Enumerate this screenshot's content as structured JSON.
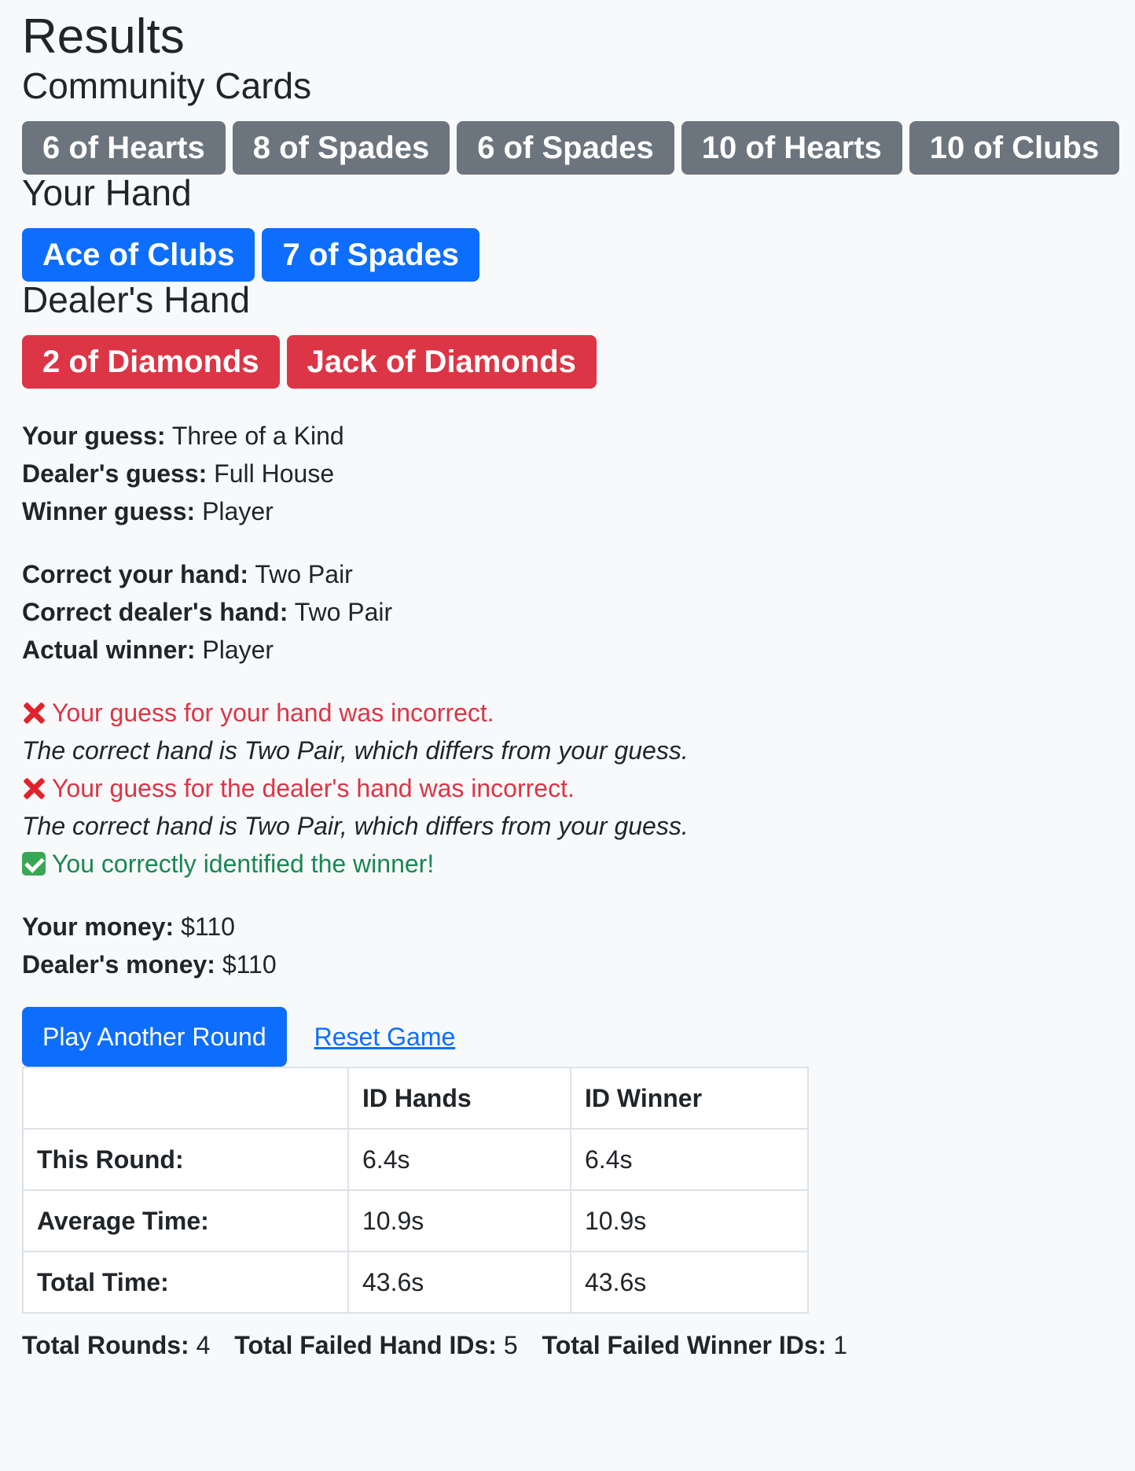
{
  "title": "Results",
  "community": {
    "heading": "Community Cards",
    "cards": [
      "6 of Hearts",
      "8 of Spades",
      "6 of Spades",
      "10 of Hearts",
      "10 of Clubs"
    ]
  },
  "your_hand": {
    "heading": "Your Hand",
    "cards": [
      "Ace of Clubs",
      "7 of Spades"
    ]
  },
  "dealer_hand": {
    "heading": "Dealer's Hand",
    "cards": [
      "2 of Diamonds",
      "Jack of Diamonds"
    ]
  },
  "guesses": {
    "your_label": "Your guess:",
    "your_value": "Three of a Kind",
    "dealer_label": "Dealer's guess:",
    "dealer_value": "Full House",
    "winner_label": "Winner guess:",
    "winner_value": "Player"
  },
  "correct": {
    "your_label": "Correct your hand:",
    "your_value": "Two Pair",
    "dealer_label": "Correct dealer's hand:",
    "dealer_value": "Two Pair",
    "winner_label": "Actual winner:",
    "winner_value": "Player"
  },
  "feedback": {
    "your_result": "Your guess for your hand was incorrect.",
    "your_explanation": "The correct hand is Two Pair, which differs from your guess.",
    "dealer_result": "Your guess for the dealer's hand was incorrect.",
    "dealer_explanation": "The correct hand is Two Pair, which differs from your guess.",
    "winner_result": "You correctly identified the winner!",
    "icons": {
      "incorrect": "cross-mark-icon",
      "correct": "check-mark-icon"
    },
    "colors": {
      "incorrect": "#dc3545",
      "correct": "#198754"
    }
  },
  "money": {
    "your_label": "Your money:",
    "your_value": "$110",
    "dealer_label": "Dealer's money:",
    "dealer_value": "$110"
  },
  "actions": {
    "play_again": "Play Another Round",
    "reset": "Reset Game"
  },
  "stats_table": {
    "headers": [
      "",
      "ID Hands",
      "ID Winner"
    ],
    "rows": [
      {
        "label": "This Round:",
        "hands": "6.4s",
        "winner": "6.4s"
      },
      {
        "label": "Average Time:",
        "hands": "10.9s",
        "winner": "10.9s"
      },
      {
        "label": "Total Time:",
        "hands": "43.6s",
        "winner": "43.6s"
      }
    ]
  },
  "totals": {
    "rounds_label": "Total Rounds:",
    "rounds_value": "4",
    "failed_hands_label": "Total Failed Hand IDs:",
    "failed_hands_value": "5",
    "failed_winner_label": "Total Failed Winner IDs:",
    "failed_winner_value": "1"
  },
  "colors": {
    "community_badge": "#6c757d",
    "player_badge": "#0d6efd",
    "dealer_badge": "#dc3545",
    "primary": "#0d6efd"
  }
}
